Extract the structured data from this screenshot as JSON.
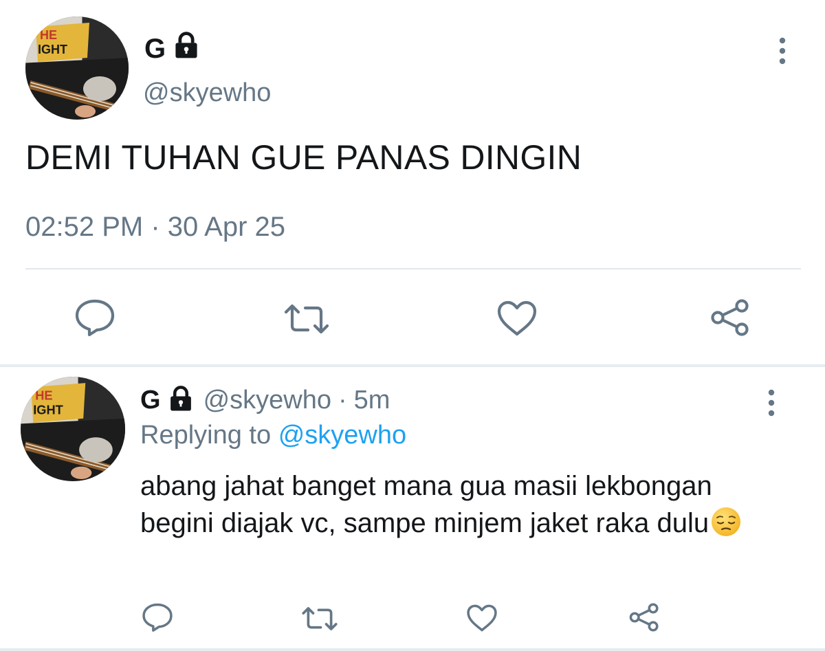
{
  "main_tweet": {
    "display_name": "G",
    "protected_icon": "lock-icon",
    "handle": "@skyewho",
    "text": "DEMI TUHAN GUE PANAS DINGIN",
    "timestamp": "02:52 PM · 30 Apr 25",
    "actions": [
      "reply-icon",
      "retweet-icon",
      "like-icon",
      "share-icon"
    ]
  },
  "reply": {
    "display_name": "G",
    "protected_icon": "lock-icon",
    "handle": "@skyewho",
    "separator": "·",
    "time": "5m",
    "replying_prefix": "Replying to",
    "replying_handle": "@skyewho",
    "text": "abang jahat banget mana gua masii lekbongan begini diajak vc, sampe minjem jaket raka dulu",
    "emoji": "pensive-face-emoji",
    "actions": [
      "reply-icon",
      "retweet-icon",
      "like-icon",
      "share-icon"
    ]
  },
  "colors": {
    "text_primary": "#14171a",
    "text_secondary": "#657786",
    "link": "#1da1f2",
    "divider": "#e1e8ed",
    "icon": "#657786"
  }
}
